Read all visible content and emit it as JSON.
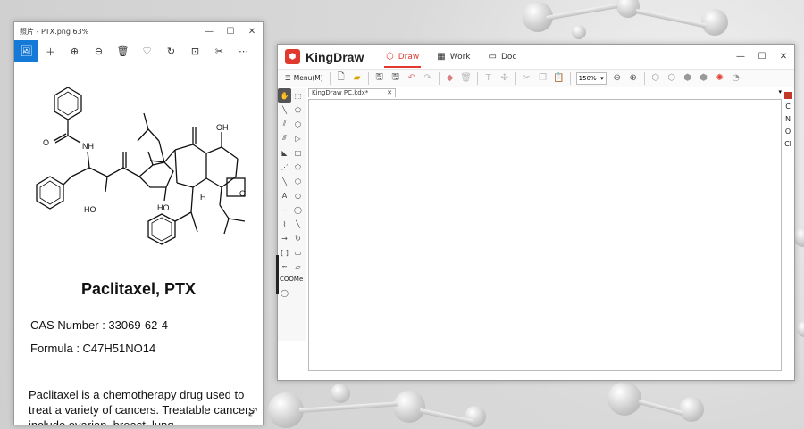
{
  "viewer": {
    "title": "照片 - PTX.png   63%",
    "window_buttons": [
      "—",
      "☐",
      "✕"
    ],
    "tools": [
      "🖼",
      "＋",
      "⊕",
      "⊖",
      "🗑",
      "♡",
      "↻",
      "⊡",
      "✂",
      "⋯"
    ],
    "molecule_name": "Paclitaxel, PTX",
    "cas_label": "CAS Number",
    "cas_value": ": 33069-62-4",
    "formula_label": "Formula",
    "formula_value": ": C47H51NO14",
    "description": "Paclitaxel is a chemotherapy drug used to treat a variety of cancers. Treatable cancers include ovarian, breast, lung,",
    "structure_labels": {
      "nh": "NH",
      "o1": "O",
      "ho1": "HO",
      "ho2": "HO",
      "oh": "OH",
      "h": "H",
      "o_ring": "O"
    }
  },
  "kingdraw": {
    "app_name": "KingDraw",
    "tabs": [
      {
        "label": "Draw",
        "icon": "⬡"
      },
      {
        "label": "Work",
        "icon": "▦"
      },
      {
        "label": "Doc",
        "icon": "▭"
      }
    ],
    "window_buttons": [
      "—",
      "☐",
      "✕"
    ],
    "menu_label": "Menu(M)",
    "zoom_value": "150%",
    "doc_tab": "KingDraw PC.kdx*",
    "coome_label": "COOMe",
    "elements": [
      "C",
      "N",
      "O",
      "Cl"
    ],
    "accent_color": "#e03a2f"
  }
}
